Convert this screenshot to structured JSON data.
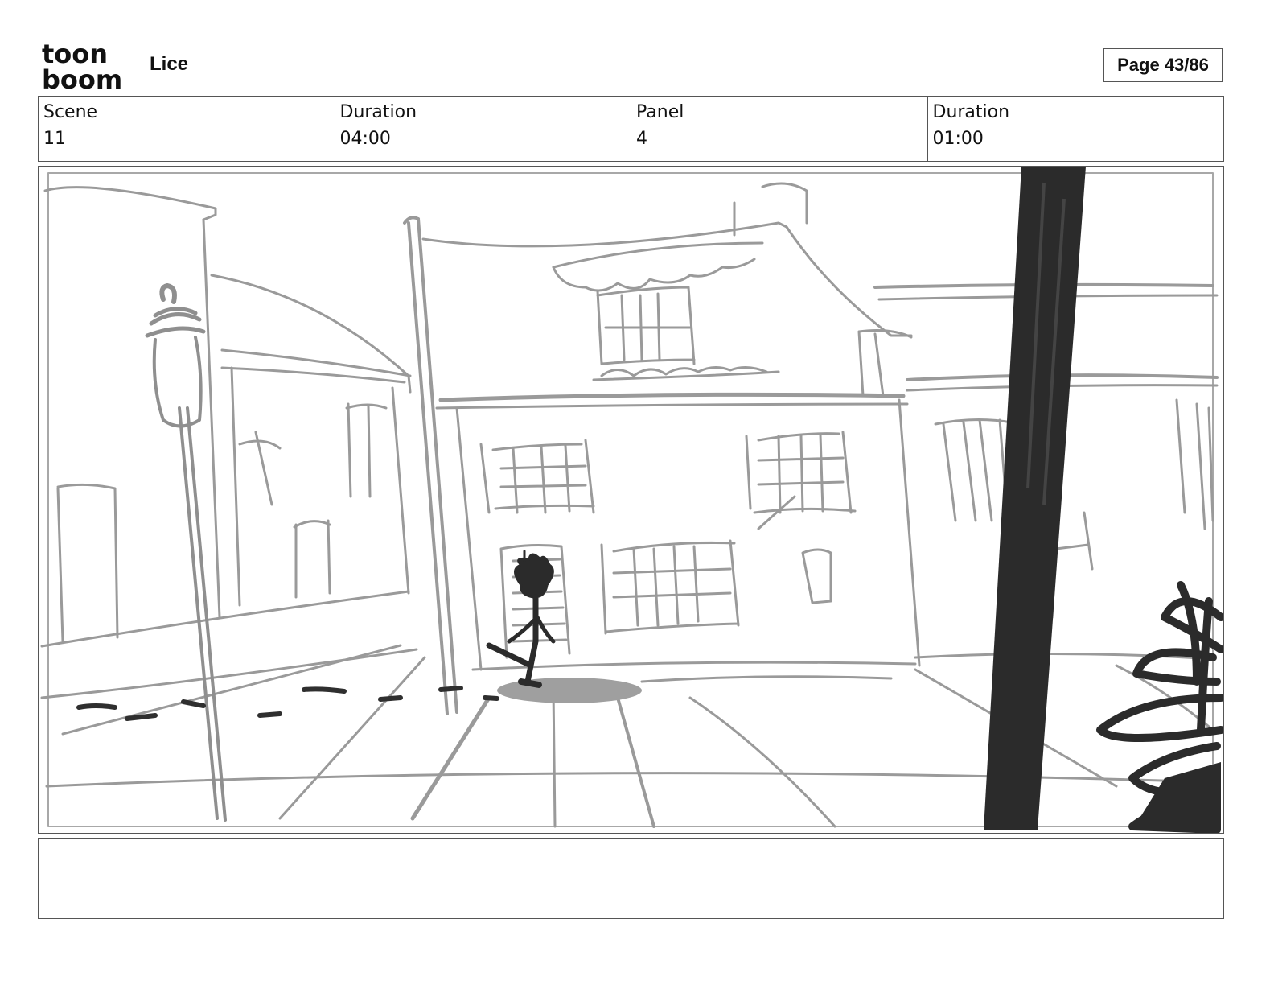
{
  "header": {
    "logo_line1": "toon",
    "logo_line2": "boom",
    "project_title": "Lice",
    "page_indicator": "Page 43/86"
  },
  "info": {
    "scene_label": "Scene",
    "scene_value": "11",
    "scene_duration_label": "Duration",
    "scene_duration_value": "04:00",
    "panel_label": "Panel",
    "panel_value": "4",
    "panel_duration_label": "Duration",
    "panel_duration_value": "01:00"
  },
  "colors": {
    "sketch_line": "#9a9a9a",
    "foreground_dark": "#2b2b2b",
    "frame_border": "#555555"
  }
}
